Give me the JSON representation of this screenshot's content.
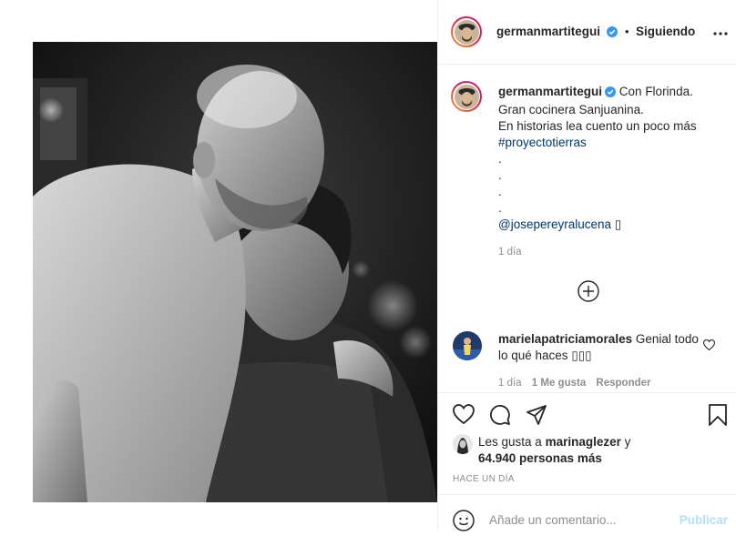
{
  "post": {
    "username": "germanmartitegui",
    "follow_state": "Siguiendo",
    "separator": "•",
    "caption": {
      "first_line": "Con Florinda.",
      "lines": [
        "Gran cocinera Sanjuanina.",
        "En historias lea cuento un poco más"
      ],
      "hashtag": "#proyectotierras",
      "dots": [
        ".",
        ".",
        ".",
        "."
      ],
      "mention": "@josepereyralucena",
      "emoji": "▯"
    },
    "caption_time": "1 día"
  },
  "comment": {
    "username": "marielapatriciamorales",
    "text": "Genial todo lo qué haces",
    "emoji": "▯▯▯",
    "time": "1 día",
    "likes": "1 Me gusta",
    "reply": "Responder"
  },
  "likes": {
    "prefix": "Les gusta a",
    "user": "marinaglezer",
    "conj": "y",
    "count": "64.940 personas más"
  },
  "timestamp": "HACE UN DÍA",
  "footer": {
    "placeholder": "Añade un comentario...",
    "publish": "Publicar"
  },
  "colors": {
    "link": "#00376b",
    "verified": "#3897f0",
    "muted": "#8e8e8e",
    "publish_disabled": "#b2dffc"
  },
  "icons": [
    "more-icon",
    "verified-icon",
    "load-more-icon",
    "heart-icon",
    "comment-icon",
    "share-icon",
    "bookmark-icon",
    "emoji-icon"
  ]
}
